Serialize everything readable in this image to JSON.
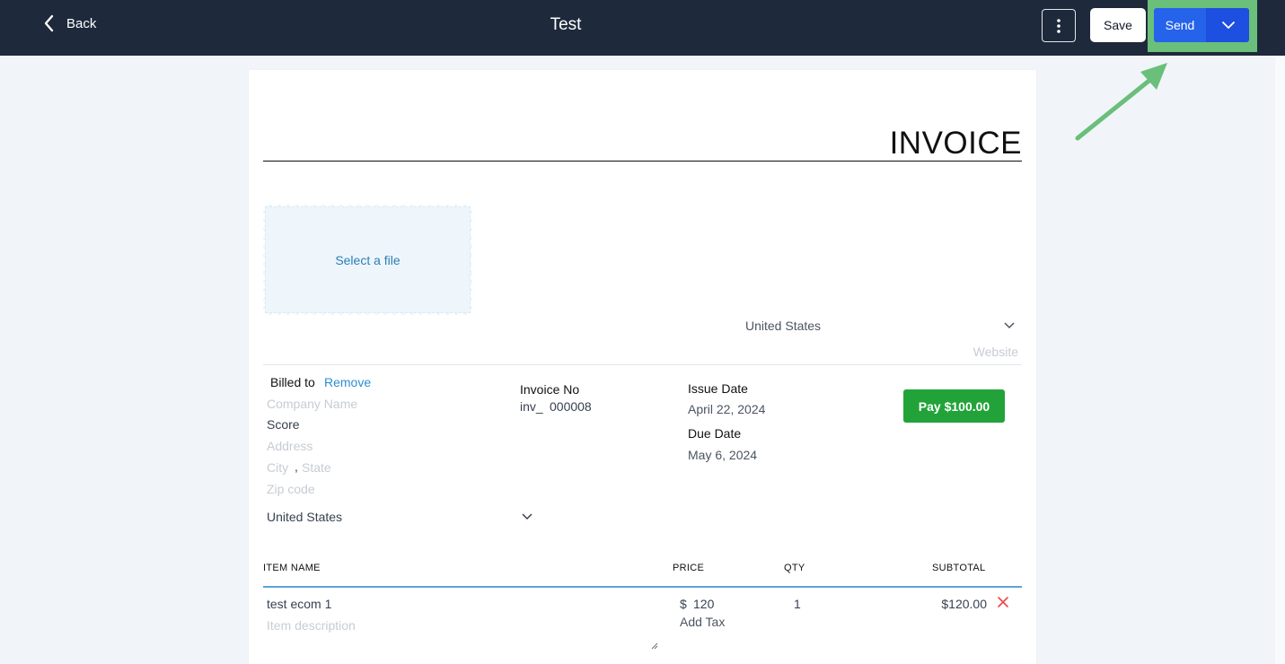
{
  "topbar": {
    "back_label": "Back",
    "title": "Test",
    "save_label": "Save",
    "send_label": "Send"
  },
  "invoice": {
    "heading": "INVOICE",
    "select_file_label": "Select a file",
    "sender_country": "United States",
    "website_placeholder": "Website",
    "billed_to_label": "Billed to",
    "remove_label": "Remove",
    "company_placeholder": "Company Name",
    "contact_value": "Score",
    "address_placeholder": "Address",
    "city_placeholder": "City",
    "city_sep": ",",
    "state_placeholder": "State",
    "zip_placeholder": "Zip code",
    "billed_country": "United States",
    "invoice_no_label": "Invoice No",
    "invoice_prefix": "inv_",
    "invoice_number": "000008",
    "issue_date_label": "Issue Date",
    "issue_date": "April 22, 2024",
    "due_date_label": "Due Date",
    "due_date": "May 6, 2024",
    "pay_label": "Pay $100.00"
  },
  "items_table": {
    "headers": {
      "item_name": "ITEM NAME",
      "price": "PRICE",
      "qty": "QTY",
      "subtotal": "SUBTOTAL"
    },
    "rows": [
      {
        "name": "test ecom 1",
        "description_placeholder": "Item description",
        "currency": "$",
        "price": "120",
        "add_tax_label": "Add Tax",
        "qty": "1",
        "subtotal": "$120.00"
      }
    ]
  },
  "colors": {
    "topbar": "#1e293b",
    "send": "#2563eb",
    "pay": "#22a33a",
    "highlight": "#6abf7b",
    "link": "#2b8fd1"
  }
}
